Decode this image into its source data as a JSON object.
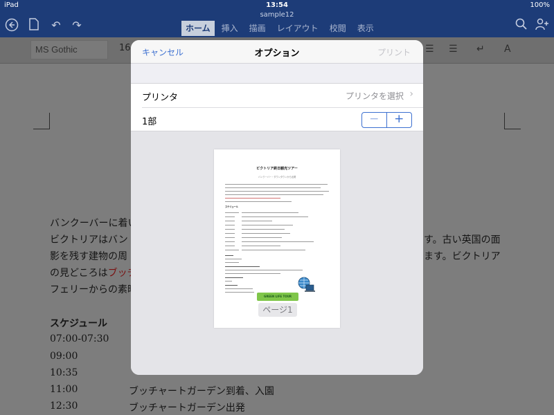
{
  "status": {
    "device": "iPad",
    "time": "13:54",
    "battery": "100%"
  },
  "app": {
    "document_title": "sample12",
    "tabs": [
      {
        "label": "ホーム",
        "active": true
      },
      {
        "label": "挿入"
      },
      {
        "label": "描画"
      },
      {
        "label": "レイアウト"
      },
      {
        "label": "校閲"
      },
      {
        "label": "表示"
      }
    ],
    "font_name": "MS Gothic",
    "font_size": "16"
  },
  "document": {
    "paragraph_lines": [
      "バンクーバーに着い",
      "ビクトリアはバン",
      "影を残す建物の周",
      "の見どころは",
      "フェリーからの素晴"
    ],
    "red_fragment": "ブッチ",
    "right_fragments": [
      "す。古い英国の面",
      "ます。ビクトリア"
    ],
    "schedule_heading": "スケジュール",
    "schedule": [
      {
        "time": "07:00-07:30",
        "desc": ""
      },
      {
        "time": "09:00",
        "desc": ""
      },
      {
        "time": "10:35",
        "desc": ""
      },
      {
        "time": "11:00",
        "desc": "ブッチャートガーデン到着、入園"
      },
      {
        "time": "12:30",
        "desc": "ブッチャートガーデン出発"
      }
    ]
  },
  "modal": {
    "cancel": "キャンセル",
    "title": "オプション",
    "print": "プリント",
    "printer_label": "プリンタ",
    "printer_value": "プリンタを選択",
    "copies_label": "1部",
    "minus": "−",
    "plus": "+",
    "page_badge": "ページ1",
    "preview": {
      "title": "ビクトリア終日観光ツアー",
      "subtitle": "バンクーバー・ダウンタウンから出発",
      "schedule_heading": "スケジュール",
      "banner": "GREEN LIFE TOUR"
    }
  },
  "colors": {
    "header_blue": "#1d3c78",
    "accent_blue": "#3b6fd0",
    "disabled_gray": "#c3c3c8"
  }
}
